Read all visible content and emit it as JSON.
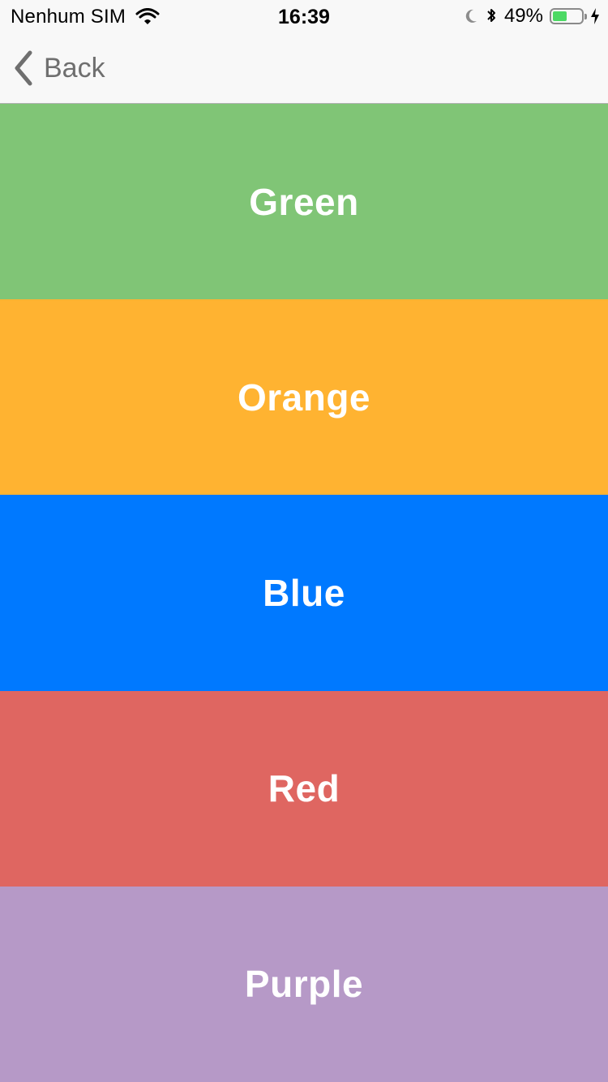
{
  "status_bar": {
    "carrier": "Nenhum SIM",
    "time": "16:39",
    "battery_percent": "49%",
    "battery_level": 0.49,
    "icons": [
      "wifi-icon",
      "moon-icon",
      "bluetooth-icon",
      "battery-icon",
      "charging-icon"
    ]
  },
  "nav": {
    "back_label": "Back",
    "back_icon": "chevron-left-icon"
  },
  "colors": [
    {
      "label": "Green",
      "hex": "#80c576"
    },
    {
      "label": "Orange",
      "hex": "#ffb331"
    },
    {
      "label": "Blue",
      "hex": "#0079ff"
    },
    {
      "label": "Red",
      "hex": "#df6661"
    },
    {
      "label": "Purple",
      "hex": "#b699c7"
    }
  ]
}
